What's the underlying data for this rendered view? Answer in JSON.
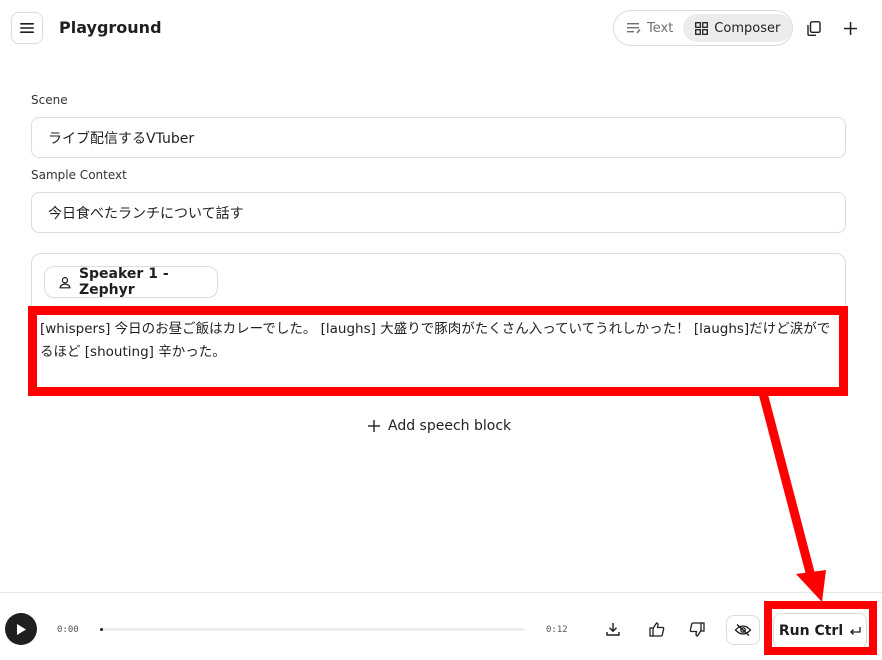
{
  "header": {
    "title": "Playground",
    "modes": [
      {
        "label": "Text",
        "icon": "text-lines-icon",
        "active": false
      },
      {
        "label": "Composer",
        "icon": "grid-icon",
        "active": true
      }
    ],
    "icons": [
      "menu-icon",
      "copy-icon",
      "plus-icon"
    ]
  },
  "form": {
    "scene_label": "Scene",
    "scene_value": "ライブ配信するVTuber",
    "context_label": "Sample Context",
    "context_value": "今日食べたランチについて話す"
  },
  "speech_block": {
    "speaker_label": "Speaker 1 - Zephyr",
    "speaker_icon": "person-icon",
    "text": "[whispers] 今日のお昼ご飯はカレーでした。 [laughs] 大盛りで豚肉がたくさん入っていてうれしかった！ [laughs]だけど涙がでるほど [shouting] 辛かった。"
  },
  "add_block_label": "Add speech block",
  "player": {
    "current_time": "0:00",
    "total_time": "0:12",
    "progress": 0.005,
    "run_label": "Run Ctrl",
    "run_shortcut_icon": "enter-icon"
  },
  "colors": {
    "annotation": "#ff0000",
    "text": "#1f1f1f",
    "border": "#dcdcdc"
  }
}
